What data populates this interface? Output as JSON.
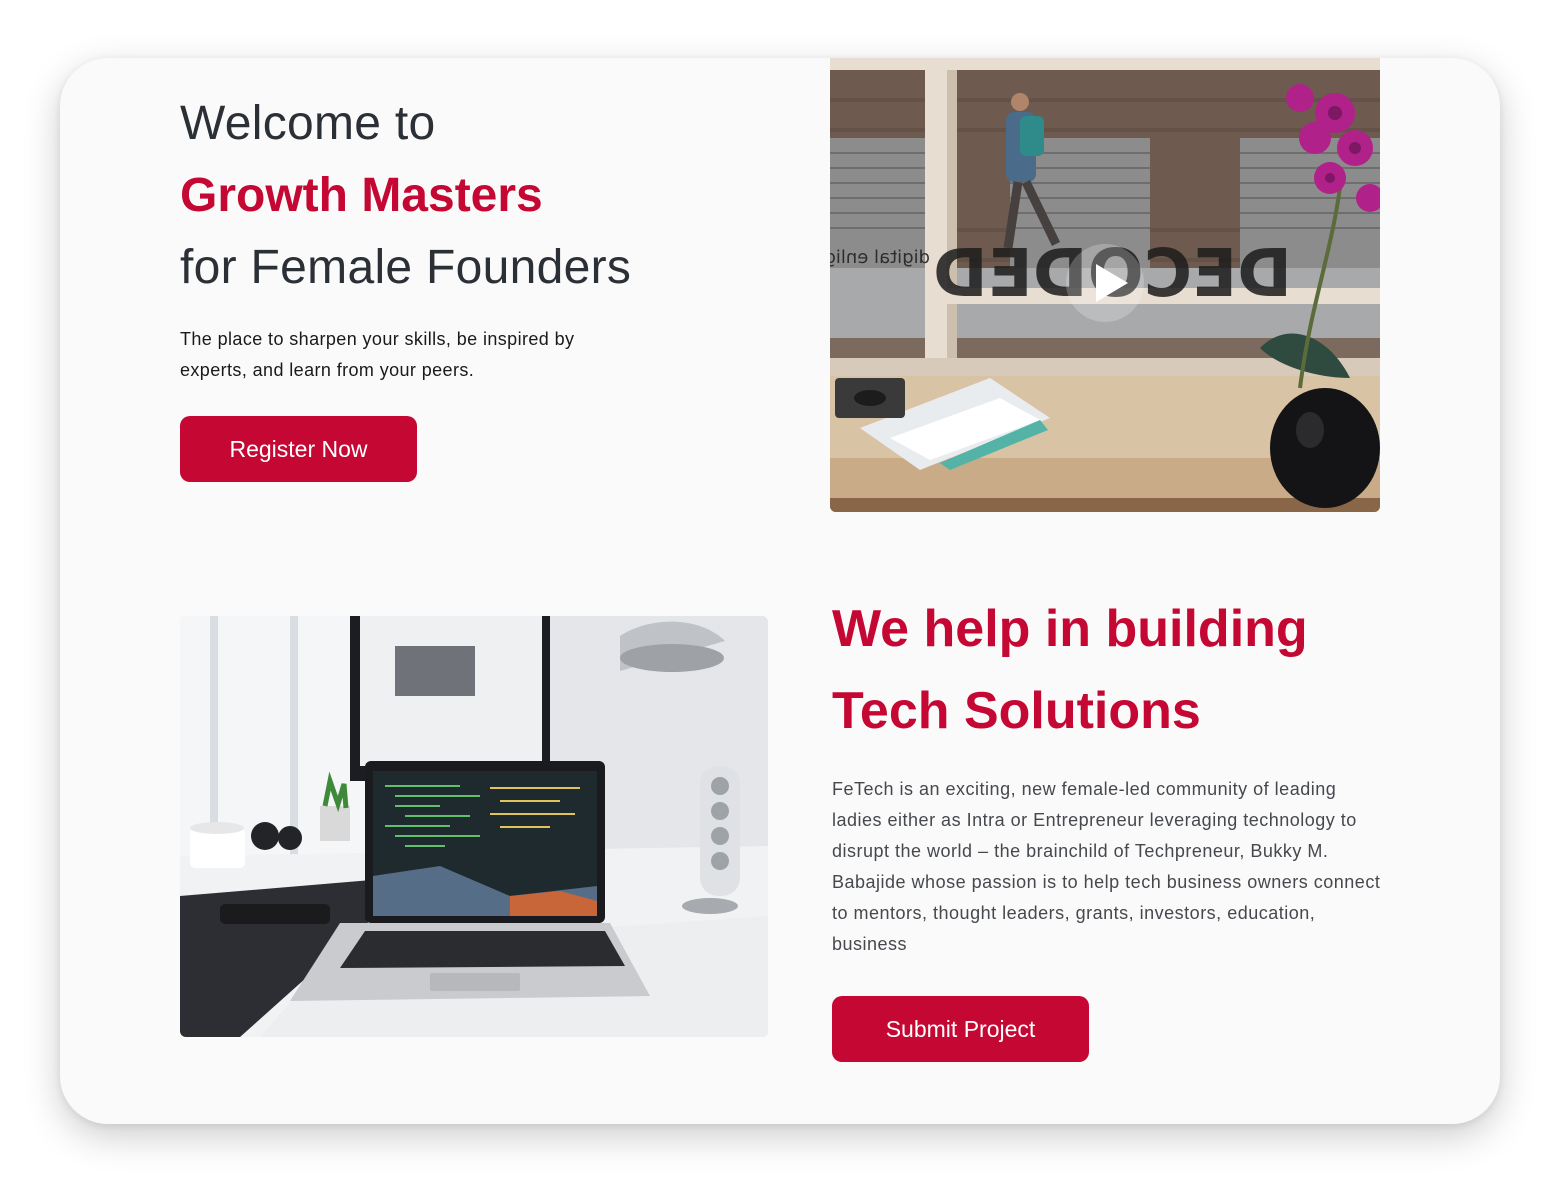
{
  "hero": {
    "welcome": "Welcome to",
    "brand": "Growth Masters",
    "subtitle": "for Female Founders",
    "lede": "The place to sharpen your skills, be inspired by experts, and learn from your peers.",
    "cta_label": "Register Now"
  },
  "video": {
    "play_icon": "play-icon",
    "window_lettering": "DECODED",
    "window_small_lettering": "digital enlight"
  },
  "tech": {
    "heading_line1": "We help in building",
    "heading_line2": "Tech Solutions",
    "body": "FeTech is an exciting, new female-led community of leading ladies either as Intra or Entrepreneur leveraging technology to disrupt the world – the brainchild of Techpreneur, Bukky M. Babajide whose passion is to help tech business owners connect to mentors, thought leaders, grants, investors, education, business",
    "cta_label": "Submit Project"
  },
  "colors": {
    "accent": "#c40733",
    "heading_dark": "#2b2f36",
    "body_text": "#45484d",
    "card_bg": "#fafafa"
  }
}
